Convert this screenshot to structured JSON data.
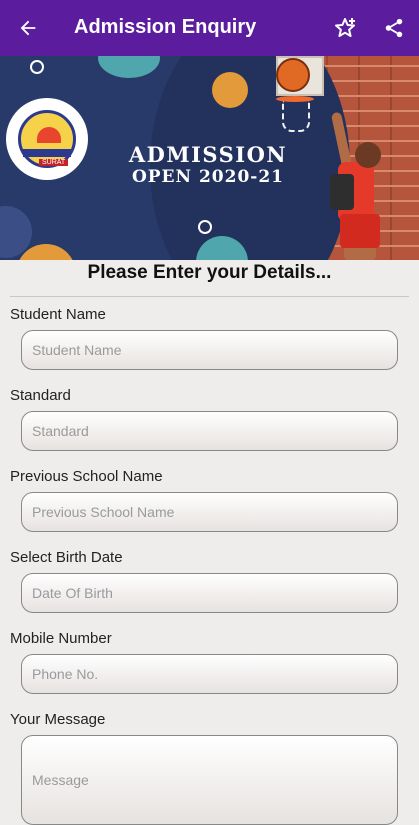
{
  "appbar": {
    "title": "Admission Enquiry",
    "back_icon": "arrow-back-icon",
    "favorite_icon": "star-add-icon",
    "share_icon": "share-icon",
    "color": "#5b1d9e"
  },
  "banner": {
    "line1": "ADMISSION",
    "line2": "OPEN 2020-21",
    "logo_city": "SURAT"
  },
  "form": {
    "heading": "Please Enter your Details...",
    "fields": [
      {
        "label": "Student Name",
        "placeholder": "Student Name"
      },
      {
        "label": "Standard",
        "placeholder": "Standard"
      },
      {
        "label": "Previous School Name",
        "placeholder": "Previous School Name"
      },
      {
        "label": "Select Birth Date",
        "placeholder": "Date Of Birth"
      },
      {
        "label": "Mobile Number",
        "placeholder": "Phone No."
      },
      {
        "label": "Your Message",
        "placeholder": "Message"
      }
    ]
  }
}
